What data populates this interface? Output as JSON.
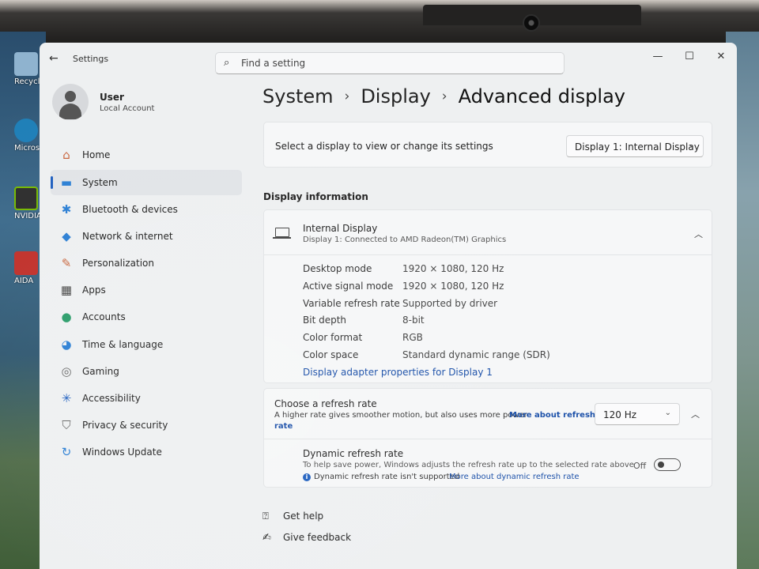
{
  "desktop": {
    "icons": [
      {
        "label": "Recycle",
        "color": "#8fb3cf"
      },
      {
        "label": "Micros Edge",
        "color": "#1f7fb8"
      },
      {
        "label": "NVIDIA",
        "color": "#2d2d2d"
      },
      {
        "label": "AIDA",
        "color": "#c0302a"
      }
    ]
  },
  "window": {
    "title": "Settings",
    "search_placeholder": "Find a setting",
    "controls": {
      "minimize": "—",
      "maximize": "☐",
      "close": "✕"
    }
  },
  "user": {
    "name": "User",
    "account": "Local Account"
  },
  "sidebar": {
    "items": [
      {
        "label": "Home",
        "icon": "home-icon",
        "glyph": "⌂",
        "color": "#c8643c"
      },
      {
        "label": "System",
        "icon": "system-icon",
        "glyph": "▬",
        "color": "#2b7fd4",
        "active": true
      },
      {
        "label": "Bluetooth & devices",
        "icon": "bluetooth-icon",
        "glyph": "✱",
        "color": "#2b7fd4"
      },
      {
        "label": "Network & internet",
        "icon": "network-icon",
        "glyph": "◆",
        "color": "#2b7fd4"
      },
      {
        "label": "Personalization",
        "icon": "brush-icon",
        "glyph": "✎",
        "color": "#c8643c"
      },
      {
        "label": "Apps",
        "icon": "apps-icon",
        "glyph": "▦",
        "color": "#444"
      },
      {
        "label": "Accounts",
        "icon": "accounts-icon",
        "glyph": "●",
        "color": "#2a9d6a"
      },
      {
        "label": "Time & language",
        "icon": "globe-icon",
        "glyph": "◕",
        "color": "#2b7fd4"
      },
      {
        "label": "Gaming",
        "icon": "gaming-icon",
        "glyph": "◎",
        "color": "#666"
      },
      {
        "label": "Accessibility",
        "icon": "accessibility-icon",
        "glyph": "✳",
        "color": "#1f5fbf"
      },
      {
        "label": "Privacy & security",
        "icon": "shield-icon",
        "glyph": "⛉",
        "color": "#666"
      },
      {
        "label": "Windows Update",
        "icon": "update-icon",
        "glyph": "↻",
        "color": "#2b7fd4"
      }
    ]
  },
  "breadcrumb": {
    "parts": [
      "System",
      "Display",
      "Advanced display"
    ],
    "sep": "›"
  },
  "display_select": {
    "text": "Select a display to view or change its settings",
    "value": "Display 1: Internal Display"
  },
  "display_info": {
    "heading": "Display information",
    "title": "Internal Display",
    "subtitle": "Display 1: Connected to AMD Radeon(TM) Graphics",
    "rows": [
      {
        "k": "Desktop mode",
        "v": "1920 × 1080, 120 Hz"
      },
      {
        "k": "Active signal mode",
        "v": "1920 × 1080, 120 Hz"
      },
      {
        "k": "Variable refresh rate",
        "v": "Supported by driver"
      },
      {
        "k": "Bit depth",
        "v": "8-bit"
      },
      {
        "k": "Color format",
        "v": "RGB"
      },
      {
        "k": "Color space",
        "v": "Standard dynamic range (SDR)"
      }
    ],
    "adapter_link": "Display adapter properties for Display 1"
  },
  "refresh": {
    "title": "Choose a refresh rate",
    "desc": "A higher rate gives smoother motion, but also uses more power",
    "link_a": "More about refresh",
    "link_b": "rate",
    "value": "120 Hz",
    "dynamic": {
      "title": "Dynamic refresh rate",
      "desc": "To help save power, Windows adjusts the refresh rate up to the selected rate above",
      "note": "Dynamic refresh rate isn't supported",
      "note_link": "More about dynamic refresh rate",
      "toggle_label": "Off",
      "toggle_on": false
    }
  },
  "help": {
    "get_help": "Get help",
    "feedback": "Give feedback"
  }
}
